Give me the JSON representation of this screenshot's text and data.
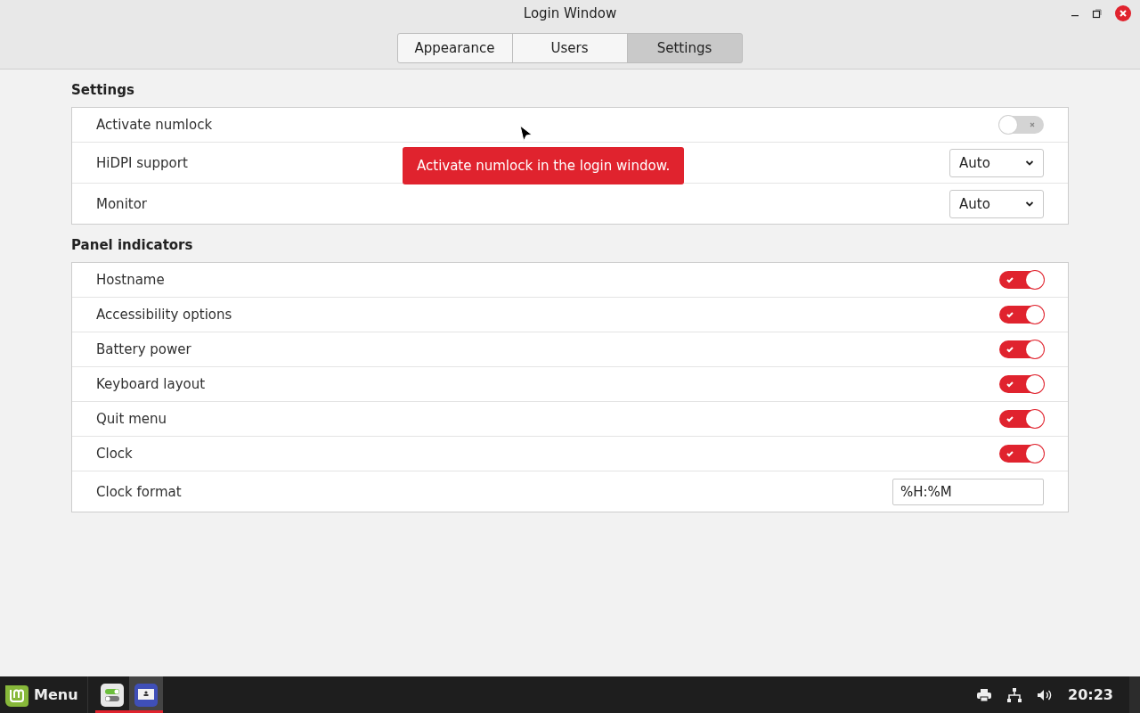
{
  "window": {
    "title": "Login Window"
  },
  "tabs": [
    {
      "label": "Appearance",
      "selected": false
    },
    {
      "label": "Users",
      "selected": false
    },
    {
      "label": "Settings",
      "selected": true
    }
  ],
  "sections": [
    {
      "title": "Settings",
      "rows": [
        {
          "kind": "toggle",
          "label": "Activate numlock",
          "on": false
        },
        {
          "kind": "dropdown",
          "label": "HiDPI support",
          "value": "Auto"
        },
        {
          "kind": "dropdown",
          "label": "Monitor",
          "value": "Auto"
        }
      ]
    },
    {
      "title": "Panel indicators",
      "rows": [
        {
          "kind": "toggle",
          "label": "Hostname",
          "on": true
        },
        {
          "kind": "toggle",
          "label": "Accessibility options",
          "on": true
        },
        {
          "kind": "toggle",
          "label": "Battery power",
          "on": true
        },
        {
          "kind": "toggle",
          "label": "Keyboard layout",
          "on": true
        },
        {
          "kind": "toggle",
          "label": "Quit menu",
          "on": true
        },
        {
          "kind": "toggle",
          "label": "Clock",
          "on": true
        },
        {
          "kind": "entry",
          "label": "Clock format",
          "value": "%H:%M"
        }
      ]
    }
  ],
  "tooltip": {
    "text": "Activate numlock in the login window."
  },
  "taskbar": {
    "menu_label": "Menu",
    "apps": [
      {
        "kind": "settings",
        "selected": false
      },
      {
        "kind": "login",
        "selected": true
      }
    ],
    "clock": "20:23"
  }
}
